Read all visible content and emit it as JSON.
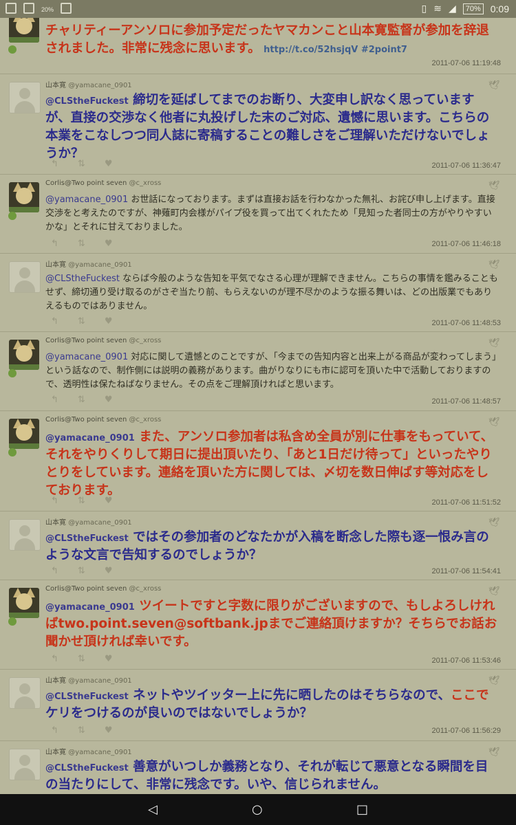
{
  "status": {
    "time": "0:09",
    "battery": "70%",
    "small_battery": "20%"
  },
  "tweets": [
    {
      "author": "",
      "handle": "",
      "segments": [
        {
          "t": "チャリティーアンソロに参加予定だったヤマカンこと山本寛監督が参加を辞退されました。非常に残念に思います。",
          "c": "red"
        },
        {
          "t": "  http://t.co/52hsjqV  #2point7",
          "c": "link"
        }
      ],
      "time": "2011-07-06 11:19:48"
    },
    {
      "author": "山本寛",
      "handle": "@yamacane_0901",
      "segments": [
        {
          "t": "@CLStheFuckest",
          "c": "mention"
        },
        {
          "t": " 締切を延ばしてまでのお断り、大変申し訳なく思っていますが、直接の交渉なく他者に丸投げした末のご対応、遺憾に思います。こちらの本業をこなしつつ同人誌に寄稿することの難しさをご理解いただけないでしょうか？",
          "c": "blue"
        }
      ],
      "time": "2011-07-06 11:36:47"
    },
    {
      "author": "Corlis@Two point seven",
      "handle": "@c_xross",
      "segments": [
        {
          "t": "@yamacane_0901",
          "c": "mention"
        },
        {
          "t": " お世話になっております。まずは直接お話を行わなかった無礼、お詫び申し上げます。直接交渉をと考えたのですが、神薙町内会様がパイプ役を買って出てくれたため「見知った者同士の方がやりやすいかな」とそれに甘えておりました。",
          "c": "plain"
        }
      ],
      "time": "2011-07-06 11:46:18"
    },
    {
      "author": "山本寛",
      "handle": "@yamacane_0901",
      "segments": [
        {
          "t": "@CLStheFuckest",
          "c": "mention"
        },
        {
          "t": " ならば今般のような告知を平気でなさる心理が理解できません。こちらの事情を鑑みることもせず、締切通り受け取るのがさぞ当たり前、もらえないのが理不尽かのような振る舞いは、どの出版業でもありえるものではありません。",
          "c": "plain"
        }
      ],
      "time": "2011-07-06 11:48:53"
    },
    {
      "author": "Corlis@Two point seven",
      "handle": "@c_xross",
      "segments": [
        {
          "t": "@yamacane_0901",
          "c": "mention"
        },
        {
          "t": " 対応に関して遺憾とのことですが、「今までの告知内容と出来上がる商品が変わってしまう」という話なので、制作側には説明の義務があります。曲がりなりにも市に認可を頂いた中で活動しておりますので、透明性は保たねばなりません。その点をご理解頂ければと思います。",
          "c": "plain"
        }
      ],
      "time": "2011-07-06 11:48:57"
    },
    {
      "author": "Corlis@Two point seven",
      "handle": "@c_xross",
      "segments": [
        {
          "t": "@yamacane_0901",
          "c": "mention"
        },
        {
          "t": " また、アンソロ参加者は私含め全員が別に仕事をもっていて、それをやりくりして期日に提出頂いたり、「あと1日だけ待って」といったやりとりをしています。連絡を頂いた方に関しては、〆切を数日伸ばす等対応をしております。",
          "c": "red"
        }
      ],
      "time": "2011-07-06 11:51:52"
    },
    {
      "author": "山本寛",
      "handle": "@yamacane_0901",
      "segments": [
        {
          "t": "@CLStheFuckest",
          "c": "mention"
        },
        {
          "t": " ではその参加者のどなたかが入稿を断念した際も逐一恨み言のような文言で告知するのでしょうか？",
          "c": "blue"
        }
      ],
      "time": "2011-07-06 11:54:41"
    },
    {
      "author": "Corlis@Two point seven",
      "handle": "@c_xross",
      "segments": [
        {
          "t": "@yamacane_0901",
          "c": "mention"
        },
        {
          "t": " ツイートですと字数に限りがございますので、もしよろしければtwo.point.seven@softbank.jpまでご連絡頂けますか？そちらでお話お聞かせ頂ければ幸いです。",
          "c": "red"
        }
      ],
      "time": "2011-07-06 11:53:46"
    },
    {
      "author": "山本寛",
      "handle": "@yamacane_0901",
      "segments": [
        {
          "t": "@CLStheFuckest",
          "c": "mention"
        },
        {
          "t": " ネットやツイッター上に先に晒したのはそちらなので、",
          "c": "blue"
        },
        {
          "t": "ここで",
          "c": "red"
        },
        {
          "t": "ケリをつけるのが良いのではないでしょうか？",
          "c": "blue"
        }
      ],
      "time": "2011-07-06 11:56:29"
    },
    {
      "author": "山本寛",
      "handle": "@yamacane_0901",
      "segments": [
        {
          "t": "@CLStheFuckest",
          "c": "mention"
        },
        {
          "t": " 善意がいつしか義務となり、それが転じて悪意となる瞬間を目の当たりにして、非常に残念です。いや、信じられません。",
          "c": "blue"
        }
      ],
      "time": ""
    }
  ],
  "nav": {
    "back": "◁",
    "home": "○",
    "recents": "□"
  }
}
